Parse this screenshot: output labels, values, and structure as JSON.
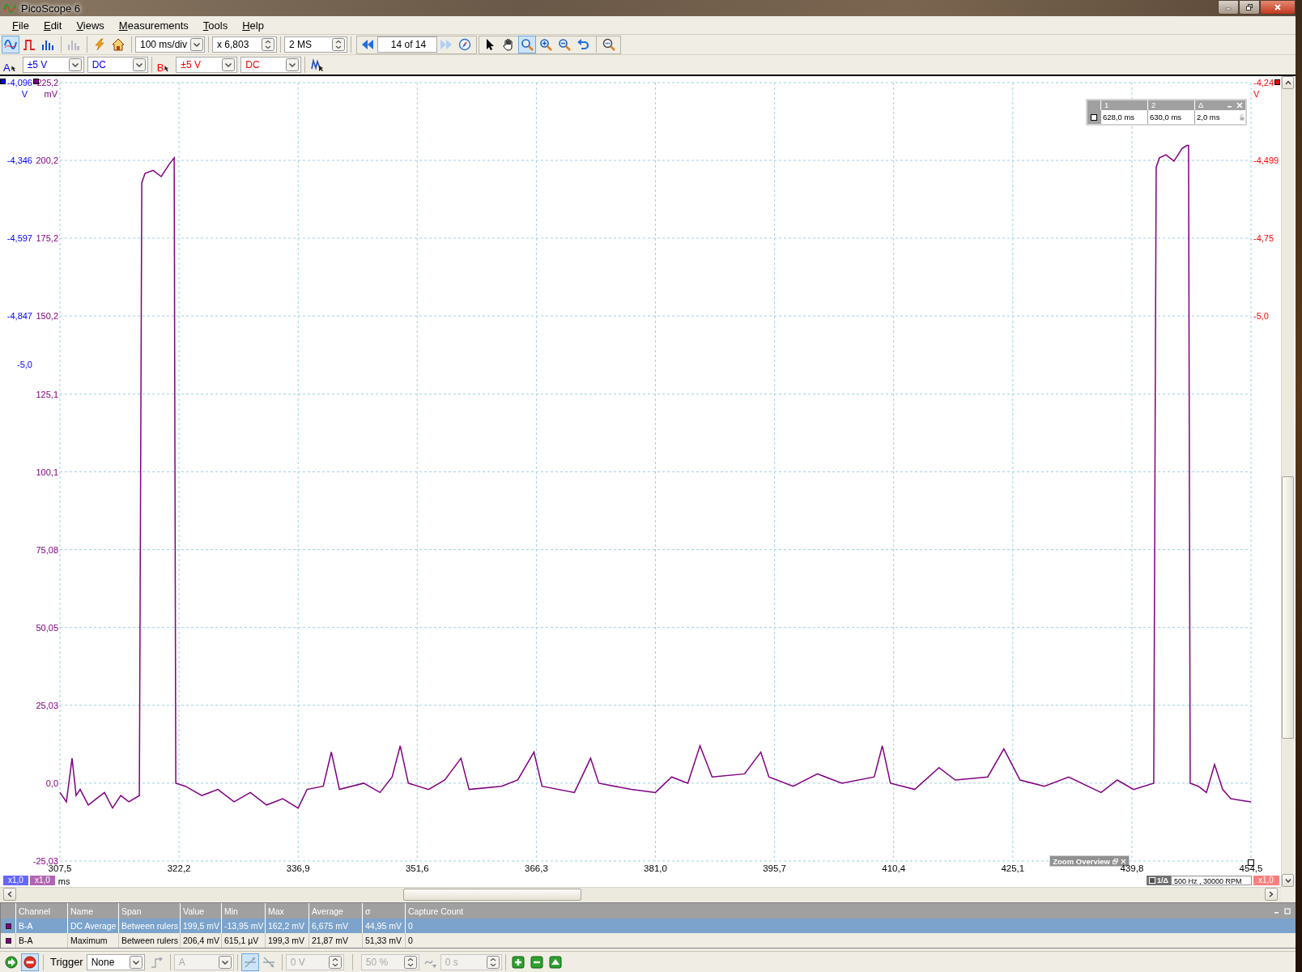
{
  "window": {
    "title": "PicoScope 6"
  },
  "menu": [
    {
      "label": "File"
    },
    {
      "label": "Edit"
    },
    {
      "label": "Views"
    },
    {
      "label": "Measurements"
    },
    {
      "label": "Tools"
    },
    {
      "label": "Help"
    }
  ],
  "toolbar": {
    "view_modes": [
      {
        "selected": true
      },
      {
        "selected": false
      },
      {
        "selected": false
      }
    ],
    "timebase": "100 ms/div",
    "zoom": "x 6,803",
    "samples": "2 MS",
    "buffer": "14 of 14",
    "tools": [
      {
        "selected": false
      },
      {
        "selected": false
      },
      {
        "selected": true
      },
      {
        "selected": false
      },
      {
        "selected": false
      },
      {
        "selected": false
      },
      {
        "selected": false
      }
    ]
  },
  "channels": [
    {
      "letter": "A",
      "color": "#0000ff",
      "range": "±5 V",
      "coupling": "DC"
    },
    {
      "letter": "B",
      "color": "#ff0000",
      "range": "±5 V",
      "coupling": "DC"
    }
  ],
  "scope": {
    "axis_a": {
      "unit": "V",
      "ticks": [
        "-4,096",
        "-4,346",
        "-4,597",
        "-4,847",
        "-5,0"
      ]
    },
    "axis_b": {
      "unit": "V",
      "ticks": [
        "-4,24",
        "-4,499",
        "-4,75",
        "-5,0"
      ]
    },
    "chart_data": {
      "type": "line",
      "grid": true,
      "xlabel": "ms",
      "ylabel": "mV",
      "xlim": [
        307.5,
        454.5
      ],
      "ylim": [
        -25.03,
        225.2
      ],
      "xticks": [
        {
          "value": 307.5,
          "label": "307,5"
        },
        {
          "value": 322.2,
          "label": "322,2"
        },
        {
          "value": 336.9,
          "label": "336,9"
        },
        {
          "value": 351.6,
          "label": "351,6"
        },
        {
          "value": 366.3,
          "label": "366,3"
        },
        {
          "value": 381.0,
          "label": "381,0"
        },
        {
          "value": 395.7,
          "label": "395,7"
        },
        {
          "value": 410.4,
          "label": "410,4"
        },
        {
          "value": 425.1,
          "label": "425,1"
        },
        {
          "value": 439.8,
          "label": "439,8"
        },
        {
          "value": 454.5,
          "label": "454,5"
        }
      ],
      "yticks": [
        {
          "value": -25.03,
          "label": "-25,03"
        },
        {
          "value": 0,
          "label": "0,0"
        },
        {
          "value": 25.03,
          "label": "25,03"
        },
        {
          "value": 50.05,
          "label": "50,05"
        },
        {
          "value": 75.08,
          "label": "75,08"
        },
        {
          "value": 100.1,
          "label": "100,1"
        },
        {
          "value": 125.1,
          "label": "125,1"
        },
        {
          "value": 150.2,
          "label": "150,2"
        },
        {
          "value": 175.2,
          "label": "175,2"
        },
        {
          "value": 200.2,
          "label": "200,2"
        },
        {
          "value": 225.2,
          "label": "225,2"
        }
      ],
      "x": [
        307.5,
        308.3,
        309,
        309.5,
        310,
        311,
        312,
        313,
        314,
        315,
        316,
        317.3,
        317.6,
        318,
        319,
        320,
        321,
        321.6,
        321.8,
        323,
        325,
        327,
        329,
        331,
        333,
        335,
        336.9,
        338,
        340,
        341,
        342,
        345,
        347,
        348.5,
        349.5,
        350.5,
        353,
        355,
        357,
        358,
        362,
        364,
        366,
        367,
        371,
        373,
        374,
        378,
        381,
        383,
        385,
        386.5,
        388,
        392,
        394,
        395,
        398,
        401,
        404,
        408,
        409,
        410,
        413,
        416,
        418,
        422,
        424,
        426,
        429,
        432,
        436,
        438,
        440,
        442.5,
        442.8,
        443.2,
        444,
        445,
        446,
        446.6,
        446.8,
        447,
        448,
        449,
        450,
        451,
        452,
        454.5
      ],
      "series": [
        {
          "color": "#800080",
          "values": [
            -3,
            -6,
            8,
            -4,
            -2,
            -7,
            -5,
            -3,
            -8,
            -4,
            -6,
            -4,
            193,
            196,
            197,
            195,
            199,
            201,
            0,
            -1,
            -4,
            -2,
            -6,
            -3,
            -7,
            -5,
            -8,
            -2,
            -1,
            10,
            -2,
            0,
            -3,
            2,
            12,
            0,
            -2,
            1,
            8,
            -2,
            -1,
            1,
            10,
            -1,
            -3,
            8,
            0,
            -2,
            -3,
            2,
            0,
            12,
            2,
            3,
            10,
            2,
            -1,
            3,
            0,
            2,
            12,
            0,
            -2,
            5,
            1,
            2,
            11,
            1,
            -1,
            2,
            -3,
            1,
            -2,
            0,
            198,
            201,
            202,
            200,
            204,
            205,
            205,
            0,
            -1,
            -3,
            6,
            -2,
            -5,
            -6
          ]
        }
      ]
    },
    "rulers": {
      "columns": [
        "1",
        "2",
        "Δ"
      ],
      "values": [
        "628,0 ms",
        "630,0 ms",
        "2,0 ms"
      ]
    },
    "zoom_overview": "Zoom Overview",
    "scale_badges": [
      "x1,0",
      "x1,0"
    ],
    "frequency": {
      "label": "1/Δ",
      "value": "500 Hz , 30000 RPM",
      "scale": "x1,0"
    }
  },
  "measurements": {
    "columns": [
      "Channel",
      "Name",
      "Span",
      "Value",
      "Min",
      "Max",
      "Average",
      "σ",
      "Capture Count"
    ],
    "rows": [
      {
        "selected": true,
        "cells": [
          "B-A",
          "DC Average",
          "Between rulers",
          "199,5 mV",
          "-13,95 mV",
          "162,2 mV",
          "6,675 mV",
          "44,95 mV",
          "0"
        ]
      },
      {
        "selected": false,
        "cells": [
          "B-A",
          "Maximum",
          "Between rulers",
          "206,4 mV",
          "615,1 µV",
          "199,3 mV",
          "21,87 mV",
          "51,33 mV",
          "0"
        ]
      }
    ]
  },
  "trigger": {
    "label": "Trigger",
    "mode": "None",
    "channel": {
      "value": "A",
      "disabled": true
    },
    "edges": [
      {
        "selected": true
      },
      {
        "selected": false
      }
    ],
    "threshold": {
      "value": "0 V",
      "disabled": true
    },
    "pretrigger": {
      "value": "50 %",
      "disabled": true
    },
    "delay": {
      "value": "0 s",
      "disabled": true
    }
  }
}
